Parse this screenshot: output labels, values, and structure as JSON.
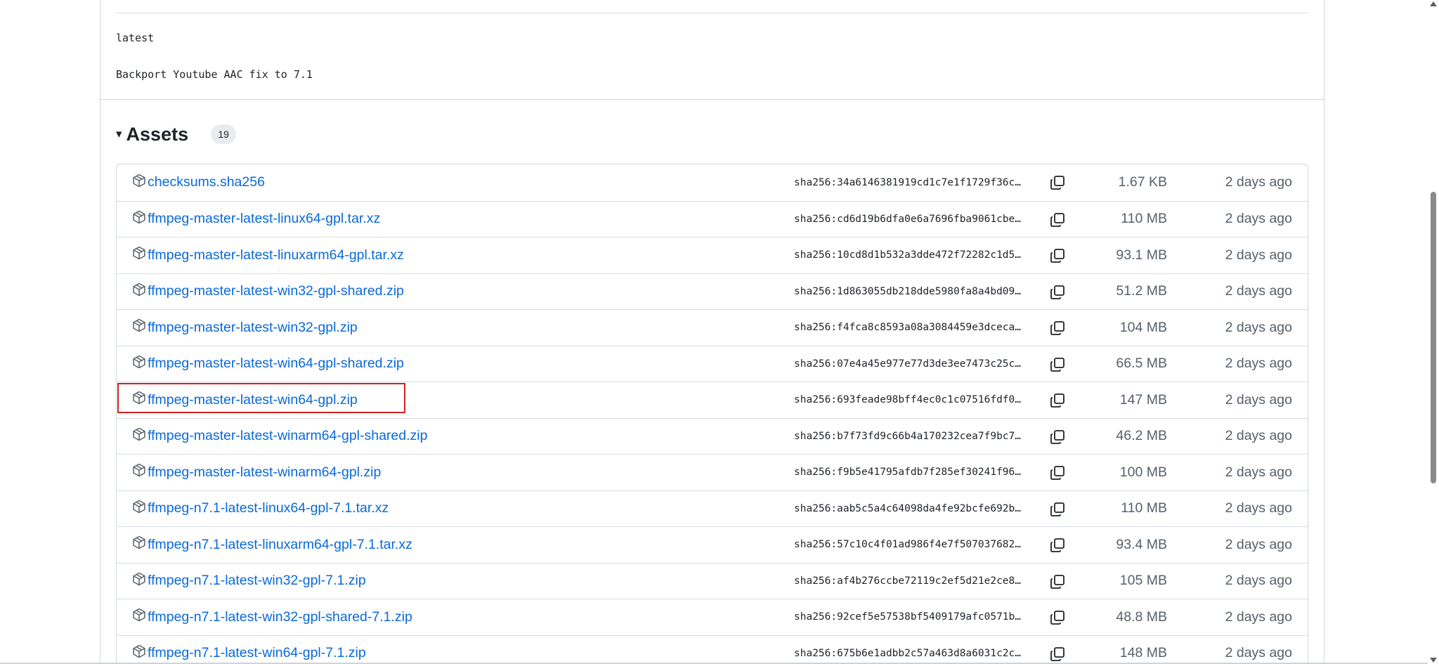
{
  "release": {
    "tag_line": "latest",
    "description_line": "Backport Youtube AAC fix to 7.1"
  },
  "assets": {
    "title": "Assets",
    "count": "19",
    "items": [
      {
        "name": "checksums.sha256",
        "sha": "sha256:34a6146381919cd1c7e1f1729f36c…",
        "size": "1.67 KB",
        "date": "2 days ago"
      },
      {
        "name": "ffmpeg-master-latest-linux64-gpl.tar.xz",
        "sha": "sha256:cd6d19b6dfa0e6a7696fba9061cbe…",
        "size": "110 MB",
        "date": "2 days ago"
      },
      {
        "name": "ffmpeg-master-latest-linuxarm64-gpl.tar.xz",
        "sha": "sha256:10cd8d1b532a3dde472f72282c1d5…",
        "size": "93.1 MB",
        "date": "2 days ago"
      },
      {
        "name": "ffmpeg-master-latest-win32-gpl-shared.zip",
        "sha": "sha256:1d863055db218dde5980fa8a4bd09…",
        "size": "51.2 MB",
        "date": "2 days ago"
      },
      {
        "name": "ffmpeg-master-latest-win32-gpl.zip",
        "sha": "sha256:f4fca8c8593a08a3084459e3dceca…",
        "size": "104 MB",
        "date": "2 days ago"
      },
      {
        "name": "ffmpeg-master-latest-win64-gpl-shared.zip",
        "sha": "sha256:07e4a45e977e77d3de3ee7473c25c…",
        "size": "66.5 MB",
        "date": "2 days ago"
      },
      {
        "name": "ffmpeg-master-latest-win64-gpl.zip",
        "sha": "sha256:693feade98bff4ec0c1c07516fdf0…",
        "size": "147 MB",
        "date": "2 days ago"
      },
      {
        "name": "ffmpeg-master-latest-winarm64-gpl-shared.zip",
        "sha": "sha256:b7f73fd9c66b4a170232cea7f9bc7…",
        "size": "46.2 MB",
        "date": "2 days ago"
      },
      {
        "name": "ffmpeg-master-latest-winarm64-gpl.zip",
        "sha": "sha256:f9b5e41795afdb7f285ef30241f96…",
        "size": "100 MB",
        "date": "2 days ago"
      },
      {
        "name": "ffmpeg-n7.1-latest-linux64-gpl-7.1.tar.xz",
        "sha": "sha256:aab5c5a4c64098da4fe92bcfe692b…",
        "size": "110 MB",
        "date": "2 days ago"
      },
      {
        "name": "ffmpeg-n7.1-latest-linuxarm64-gpl-7.1.tar.xz",
        "sha": "sha256:57c10c4f01ad986f4e7f507037682…",
        "size": "93.4 MB",
        "date": "2 days ago"
      },
      {
        "name": "ffmpeg-n7.1-latest-win32-gpl-7.1.zip",
        "sha": "sha256:af4b276ccbe72119c2ef5d21e2ce8…",
        "size": "105 MB",
        "date": "2 days ago"
      },
      {
        "name": "ffmpeg-n7.1-latest-win32-gpl-shared-7.1.zip",
        "sha": "sha256:92cef5e57538bf5409179afc0571b…",
        "size": "48.8 MB",
        "date": "2 days ago"
      },
      {
        "name": "ffmpeg-n7.1-latest-win64-gpl-7.1.zip",
        "sha": "sha256:675b6e1adbb2c57a463d8a6031c2c…",
        "size": "148 MB",
        "date": "2 days ago"
      }
    ]
  },
  "highlighted_asset": "ffmpeg-master-latest-win64-gpl.zip",
  "icons": {
    "asset": "package-icon",
    "copy": "copy-icon",
    "collapse": "caret-down-icon"
  },
  "colors": {
    "link": "#0969da",
    "highlight": "#d62020",
    "muted": "#57606a",
    "border": "#d0d7de"
  }
}
